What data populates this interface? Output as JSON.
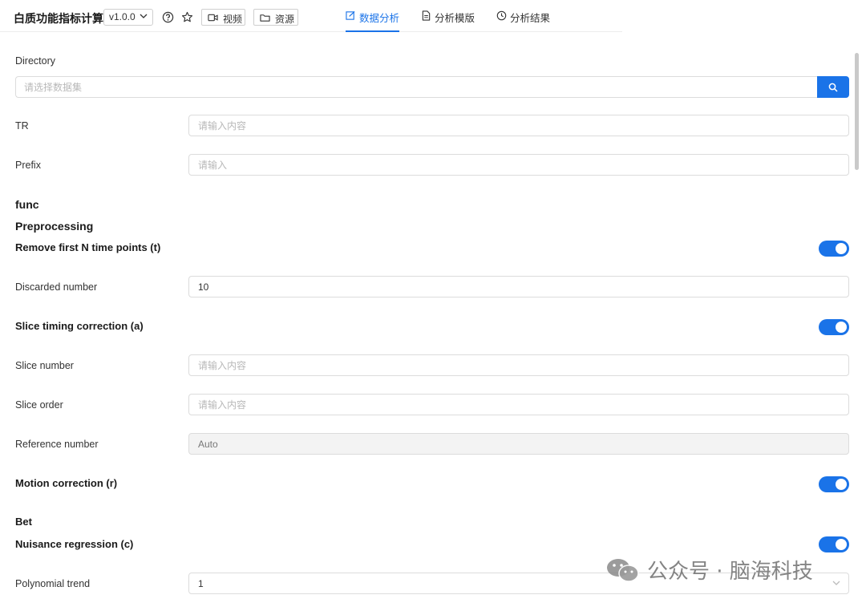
{
  "header": {
    "app_title": "白质功能指标计算",
    "version": "v1.0.0",
    "video_label": "视频",
    "resource_label": "资源",
    "tabs": [
      {
        "label": "数据分析",
        "active": true
      },
      {
        "label": "分析模版",
        "active": false
      },
      {
        "label": "分析结果",
        "active": false
      }
    ]
  },
  "form": {
    "directory": {
      "label": "Directory",
      "placeholder": "请选择数据集"
    },
    "tr": {
      "label": "TR",
      "placeholder": "请输入内容"
    },
    "prefix": {
      "label": "Prefix",
      "placeholder": "请输入"
    },
    "func_heading": "func",
    "preprocessing_heading": "Preprocessing",
    "remove_first": {
      "label": "Remove first N time points (t)",
      "enabled": true
    },
    "discarded_number": {
      "label": "Discarded number",
      "value": "10"
    },
    "slice_timing": {
      "label": "Slice timing correction (a)",
      "enabled": true
    },
    "slice_number": {
      "label": "Slice number",
      "placeholder": "请输入内容"
    },
    "slice_order": {
      "label": "Slice order",
      "placeholder": "请输入内容"
    },
    "reference_number": {
      "label": "Reference number",
      "value": "Auto"
    },
    "motion_correction": {
      "label": "Motion correction (r)",
      "enabled": true
    },
    "bet_heading": "Bet",
    "nuisance_regression": {
      "label": "Nuisance regression (c)",
      "enabled": true
    },
    "polynomial_trend": {
      "label": "Polynomial trend",
      "value": "1"
    }
  },
  "watermark": {
    "text": "公众号 · 脑海科技"
  },
  "colors": {
    "accent": "#1a73e8",
    "border": "#dcdcdc",
    "disabled_bg": "#f3f3f3"
  }
}
